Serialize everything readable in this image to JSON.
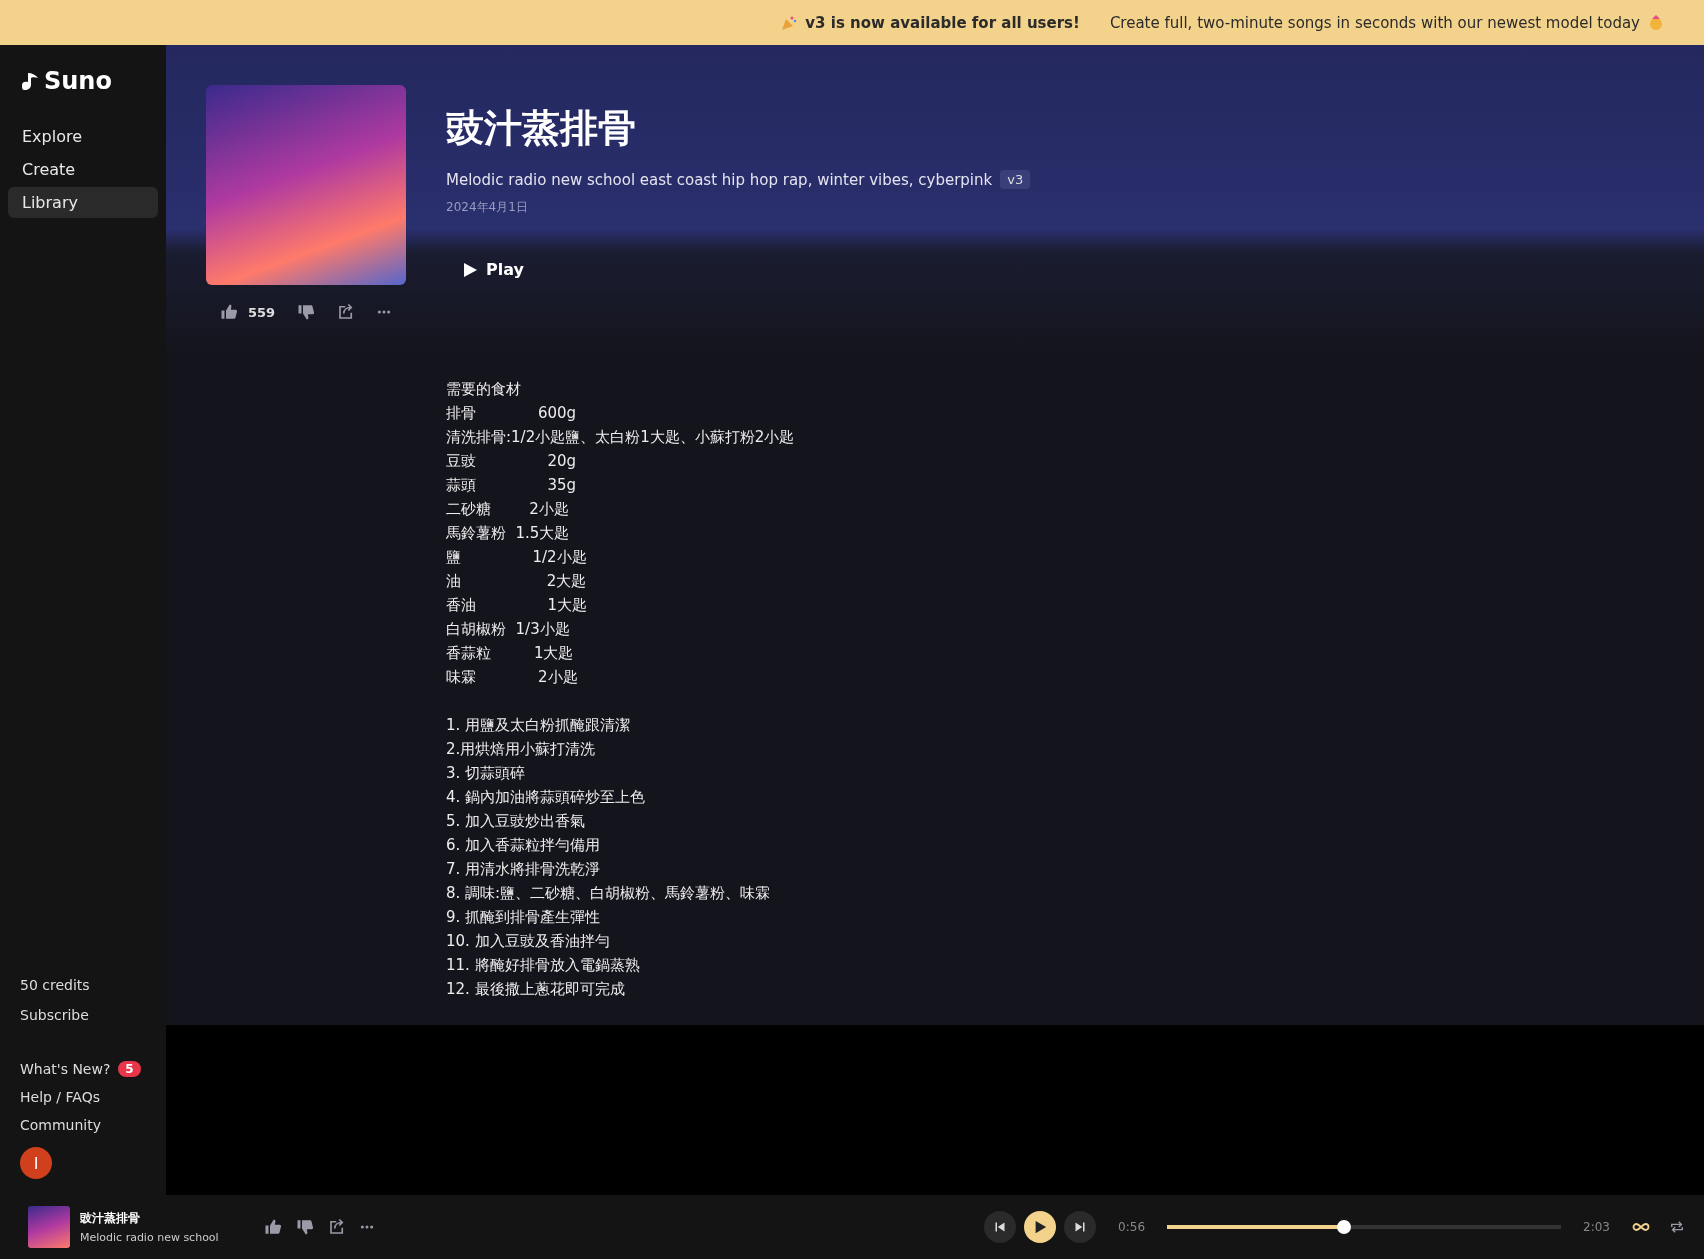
{
  "banner": {
    "headline": "v3 is now available for all users!",
    "message": "Create full, two-minute songs in seconds with our newest model today"
  },
  "sidebar": {
    "logo": "Suno",
    "items": [
      {
        "label": "Explore",
        "selected": false
      },
      {
        "label": "Create",
        "selected": false
      },
      {
        "label": "Library",
        "selected": true
      }
    ],
    "credits": "50 credits",
    "subscribe": "Subscribe",
    "links": [
      {
        "label": "What's New?",
        "badge": "5"
      },
      {
        "label": "Help / FAQs"
      },
      {
        "label": "Community"
      }
    ],
    "avatar": "I"
  },
  "song": {
    "title": "豉汁蒸排骨",
    "style": "Melodic radio new school east coast hip hop rap, winter vibes, cyberpink",
    "version": "v3",
    "date": "2024年4月1日",
    "play": "Play",
    "likes": "559"
  },
  "lyrics": {
    "ingredients": [
      "需要的食材",
      "排骨             600g",
      "清洗排骨:1/2小匙鹽、太白粉1大匙、小蘇打粉2小匙",
      "豆豉               20g",
      "蒜頭               35g",
      "二砂糖        2小匙",
      "馬鈴薯粉  1.5大匙",
      "鹽               1/2小匙",
      "油                  2大匙",
      "香油               1大匙",
      "白胡椒粉  1/3小匙",
      "香蒜粒         1大匙",
      "味霖             2小匙"
    ],
    "steps": [
      "1. 用鹽及太白粉抓醃跟清潔",
      "2.用烘焙用小蘇打清洗",
      "3. 切蒜頭碎",
      "4. 鍋內加油將蒜頭碎炒至上色",
      "5. 加入豆豉炒出香氣",
      "6. 加入香蒜粒拌勻備用",
      "7. 用清水將排骨洗乾淨",
      "8. 調味:鹽、二砂糖、白胡椒粉、馬鈴薯粉、味霖",
      "9. 抓醃到排骨產生彈性",
      "10. 加入豆豉及香油拌勻",
      "11. 將醃好排骨放入電鍋蒸熟",
      "12. 最後撒上蔥花即可完成"
    ]
  },
  "player": {
    "title": "豉汁蒸排骨",
    "subtitle": "Melodic radio new school",
    "elapsed": "0:56",
    "duration": "2:03",
    "level": 0.45
  }
}
